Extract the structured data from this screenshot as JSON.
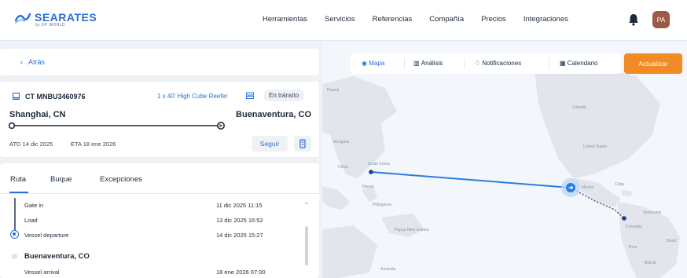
{
  "brand": {
    "name": "SEARATES",
    "subtitle": "by DP WORLD"
  },
  "nav": [
    "Herramientas",
    "Servicios",
    "Referencias",
    "Compañía",
    "Precios",
    "Integraciones"
  ],
  "user": {
    "initials": "PA"
  },
  "back": {
    "label": "Atrás"
  },
  "shipment": {
    "container_number": "CT MNBU3460976",
    "container_type": "1 x 40' High Cube Reefer",
    "status": "En tránsito",
    "origin": "Shanghai, CN",
    "destination": "Buenaventura, CO",
    "atd": "ATD 14 dic 2025",
    "eta": "ETA 18 ene 2026",
    "follow_label": "Seguir"
  },
  "tabs": [
    "Ruta",
    "Buque",
    "Excepciones"
  ],
  "events": [
    {
      "name": "Gate in",
      "time": "11 dic 2025 11:15"
    },
    {
      "name": "Load",
      "time": "13 dic 2025 16:52"
    },
    {
      "name": "Vessel departure",
      "time": "14 dic 2025 15:27"
    }
  ],
  "next_port": {
    "name": "Buenaventura, CO",
    "event": "Vessel arrival",
    "time": "18 ene 2026 07:00"
  },
  "map_toolbar": {
    "items": [
      "Mapa",
      "Análisis",
      "Notificaciones",
      "Calendario"
    ],
    "active": "Mapa",
    "update_label": "Actualizar"
  },
  "map_labels": [
    "Russia",
    "Mongolia",
    "China",
    "South Korea",
    "Taiwan",
    "Philippines",
    "Papua New Guinea",
    "Canada",
    "United States",
    "Mexico",
    "Cuba",
    "Venezuela",
    "Colombia",
    "Peru",
    "Bolivia",
    "Brazil",
    "Australia"
  ],
  "colors": {
    "accent": "#2a6fd6",
    "update_button": "#f28b24",
    "avatar": "#9a5a45"
  }
}
